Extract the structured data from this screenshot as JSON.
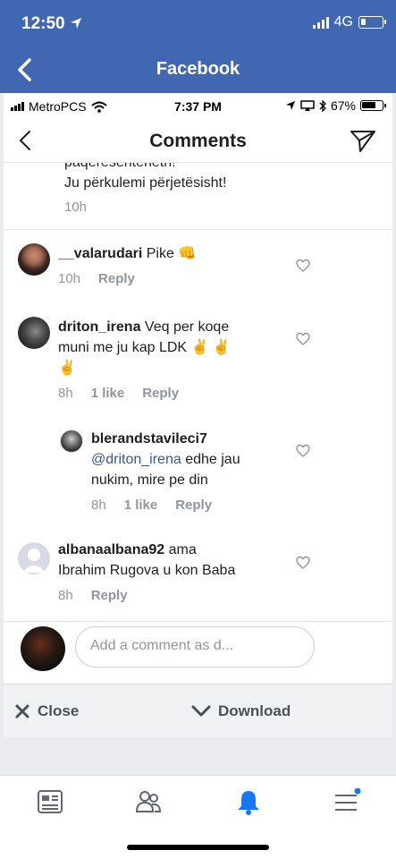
{
  "outer": {
    "status": {
      "time": "12:50",
      "network": "4G"
    },
    "nav_title": "Facebook"
  },
  "inner_status": {
    "carrier": "MetroPCS",
    "time": "7:37 PM",
    "battery": "67%"
  },
  "comments_title": "Comments",
  "partial_comment": {
    "line1": "paqeresenteneth!",
    "line2": "Ju përkulemi përjetësisht!",
    "time": "10h"
  },
  "comments": [
    {
      "user": "__valarudari",
      "text": "Pike 👊",
      "time": "10h",
      "reply": "Reply"
    },
    {
      "user": "driton_irena",
      "text_line1": "Veq per koqe",
      "text_line2": "muni me ju kap LDK ✌ ✌",
      "text_line3": "✌",
      "time": "8h",
      "likes": "1 like",
      "reply": "Reply"
    },
    {
      "user": "blerandstavileci7",
      "mention": "@driton_irena",
      "text_line1": " edhe jau",
      "text_line2": "nukim, mire pe din",
      "time": "8h",
      "likes": "1 like",
      "reply": "Reply"
    },
    {
      "user": "albanaalbana92",
      "text_line1": " ama",
      "text_line2": "Ibrahim Rugova u kon Baba",
      "time": "8h",
      "reply": "Reply"
    }
  ],
  "composer": {
    "placeholder": "Add a comment as d..."
  },
  "download_bar": {
    "close_label": "Close",
    "download_label": "Download"
  },
  "colors": {
    "facebook_blue": "#4267b2",
    "notification_blue": "#1877f2"
  },
  "icons": [
    "news-feed-icon",
    "friends-icon",
    "notifications-bell-icon",
    "menu-icon"
  ]
}
